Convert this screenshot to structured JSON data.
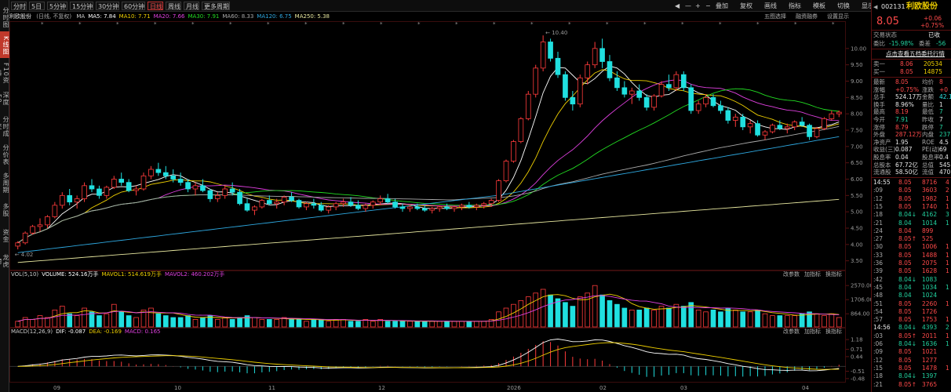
{
  "leftnav": [
    {
      "label": "分时图",
      "active": false
    },
    {
      "label": "K线图",
      "active": true
    },
    {
      "label": "F10资料",
      "active": false
    },
    {
      "label": "深度F9",
      "active": false
    },
    {
      "label": "分时成交",
      "active": false
    },
    {
      "label": "分价表",
      "active": false
    },
    {
      "label": "多周期",
      "active": false
    },
    {
      "label": "多股",
      "active": false
    },
    {
      "label": "资金",
      "active": false
    },
    {
      "label": "龙虎榜",
      "active": false
    }
  ],
  "toolbar": {
    "periods": [
      {
        "label": "分时",
        "active": false
      },
      {
        "label": "5日",
        "active": false
      },
      {
        "label": "5分钟",
        "active": false
      },
      {
        "label": "15分钟",
        "active": false
      },
      {
        "label": "30分钟",
        "active": false
      },
      {
        "label": "60分钟",
        "active": false
      },
      {
        "label": "日线",
        "active": true
      },
      {
        "label": "周线",
        "active": false
      },
      {
        "label": "月线",
        "active": false
      },
      {
        "label": "更多周期",
        "active": false
      }
    ],
    "right_items": [
      "◀",
      "—",
      "+",
      "−",
      "叠加",
      "复权",
      "画线",
      "指标",
      "模板",
      "切换",
      "显示",
      "□",
      "✕"
    ],
    "sub_items": [
      "五图选择",
      "融资融券",
      "设置显示"
    ]
  },
  "ma_legend": {
    "stock_name": "利欧股份",
    "qualifier": "(日线, 不复权)",
    "items": [
      {
        "label": "MA",
        "color": "#cccccc"
      },
      {
        "label": "MA5: 7.84",
        "color": "#ffffff"
      },
      {
        "label": "MA10: 7.71",
        "color": "#f0d000"
      },
      {
        "label": "MA20: 7.66",
        "color": "#e040e0"
      },
      {
        "label": "MA30: 7.91",
        "color": "#22dd22"
      },
      {
        "label": "MA60: 8.33",
        "color": "#aaaaaa"
      },
      {
        "label": "MA120: 6.75",
        "color": "#2ea8e0"
      },
      {
        "label": "MA250: 5.38",
        "color": "#e8e8a0"
      }
    ]
  },
  "price_axis": [
    "10.00",
    "9.50",
    "9.00",
    "8.50",
    "8.00",
    "7.50",
    "7.00",
    "6.50",
    "6.00",
    "5.50",
    "5.00",
    "4.50",
    "4.00",
    "3.50"
  ],
  "price_annotations": {
    "high": "10.40",
    "low": "4.02"
  },
  "vol_legend": {
    "items": [
      {
        "label": "VOL(5,10)",
        "color": "#cccccc"
      },
      {
        "label": "VOLUME: 524.16万手",
        "color": "#ffffff"
      },
      {
        "label": "MAVOL1: 514.619万手",
        "color": "#f0d000"
      },
      {
        "label": "MAVOL2: 460.202万手",
        "color": "#e040e0"
      }
    ],
    "axis": [
      "2570.00",
      "1706.00",
      "864.00"
    ],
    "tabs": [
      "改参数",
      "加指标",
      "换指标"
    ]
  },
  "macd_legend": {
    "items": [
      {
        "label": "MACD(12,26,9)",
        "color": "#cccccc"
      },
      {
        "label": "DIF: -0.087",
        "color": "#ffffff"
      },
      {
        "label": "DEA: -0.169",
        "color": "#f0d000"
      },
      {
        "label": "MACD: 0.165",
        "color": "#e040e0"
      }
    ],
    "axis": [
      "1.18",
      "0.71",
      "0.44",
      "-0.51",
      "-0.48"
    ],
    "tabs": [
      "改参数",
      "加指标",
      "换指标"
    ]
  },
  "time_axis": [
    "09",
    "10",
    "11",
    "12",
    "2026",
    "02",
    "03",
    "04"
  ],
  "quote": {
    "code": "002131",
    "name": "利欧股份",
    "price": "8.05",
    "change": "+0.06",
    "change_pct": "+0.75%",
    "status_label": "交易状态",
    "status_value": "已收",
    "ratio_label": "委比",
    "ratio_value": "-15.98%",
    "diff_label": "委差",
    "diff_value": "-56",
    "link_text": "点击查看五档委托行情",
    "order_book": [
      {
        "label": "卖一",
        "price": "8.06",
        "vol": "20534"
      },
      {
        "label": "买一",
        "price": "8.05",
        "vol": "14875"
      }
    ],
    "stats": [
      {
        "l1": "最新",
        "v1": "8.05",
        "c1": "red",
        "l2": "均价",
        "v2": "8",
        "c2": "red"
      },
      {
        "l1": "涨幅",
        "v1": "+0.75%",
        "c1": "red",
        "l2": "涨跌",
        "v2": "+0",
        "c2": "red"
      },
      {
        "l1": "总手",
        "v1": "524.17万",
        "c1": "white",
        "l2": "金额",
        "v2": "42.1",
        "c2": "cyan"
      },
      {
        "l1": "换手",
        "v1": "8.96%",
        "c1": "white",
        "l2": "量比",
        "v2": "1",
        "c2": "white"
      },
      {
        "l1": "最高",
        "v1": "8.19",
        "c1": "red",
        "l2": "最低",
        "v2": "7",
        "c2": "green"
      },
      {
        "l1": "今开",
        "v1": "7.91",
        "c1": "green",
        "l2": "昨收",
        "v2": "7",
        "c2": "white"
      },
      {
        "l1": "涨停",
        "v1": "8.79",
        "c1": "red",
        "l2": "跌停",
        "v2": "7",
        "c2": "green"
      },
      {
        "l1": "外盘",
        "v1": "287.12万",
        "c1": "red",
        "l2": "内盘",
        "v2": "237.0",
        "c2": "green"
      },
      {
        "l1": "净资产",
        "v1": "1.95",
        "c1": "white",
        "l2": "ROE",
        "v2": "4.5",
        "c2": "white"
      },
      {
        "l1": "收益(三)",
        "v1": "0.087",
        "c1": "white",
        "l2": "PE(动)",
        "v2": "69",
        "c2": "white"
      },
      {
        "l1": "股息率",
        "v1": "0.04",
        "c1": "white",
        "l2": "股息率",
        "v2": "0.4",
        "c2": "white"
      },
      {
        "l1": "总股本",
        "v1": "67.72亿",
        "c1": "white",
        "l2": "总值",
        "v2": "545.1",
        "c2": "white"
      },
      {
        "l1": "流通股",
        "v1": "58.50亿",
        "c1": "white",
        "l2": "流值",
        "v2": "470.9",
        "c2": "white"
      }
    ],
    "ticks": [
      {
        "t": "14:55",
        "p": "8.05",
        "v": "8716",
        "d": "4",
        "c": "red"
      },
      {
        "t": ":09",
        "p": "8.05",
        "v": "3603",
        "d": "2",
        "c": "red"
      },
      {
        "t": ":12",
        "p": "8.05",
        "v": "1982",
        "d": "1",
        "c": "red"
      },
      {
        "t": ":15",
        "p": "8.05",
        "v": "1740",
        "d": "1",
        "c": "red"
      },
      {
        "t": ":18",
        "p": "8.04↓",
        "v": "4162",
        "d": "3",
        "c": "green"
      },
      {
        "t": ":21",
        "p": "8.04",
        "v": "1014",
        "d": "1",
        "c": "green"
      },
      {
        "t": ":24",
        "p": "8.04",
        "v": "899",
        "d": "",
        "c": "red"
      },
      {
        "t": ":27",
        "p": "8.05↑",
        "v": "525",
        "d": "",
        "c": "red"
      },
      {
        "t": ":30",
        "p": "8.05",
        "v": "1006",
        "d": "1",
        "c": "red"
      },
      {
        "t": ":33",
        "p": "8.05",
        "v": "1488",
        "d": "1",
        "c": "red"
      },
      {
        "t": ":36",
        "p": "8.05",
        "v": "2075",
        "d": "1",
        "c": "red"
      },
      {
        "t": ":39",
        "p": "8.05",
        "v": "1628",
        "d": "1",
        "c": "red"
      },
      {
        "t": ":42",
        "p": "8.04↓",
        "v": "1083",
        "d": "",
        "c": "green"
      },
      {
        "t": ":45",
        "p": "8.04",
        "v": "1034",
        "d": "1",
        "c": "green"
      },
      {
        "t": ":48",
        "p": "8.04",
        "v": "1024",
        "d": "",
        "c": "green"
      },
      {
        "t": ":51",
        "p": "8.05",
        "v": "2260",
        "d": "1",
        "c": "red"
      },
      {
        "t": ":54",
        "p": "8.05",
        "v": "1726",
        "d": "",
        "c": "red"
      },
      {
        "t": ":57",
        "p": "8.05",
        "v": "1753",
        "d": "1",
        "c": "red"
      },
      {
        "t": "14:56",
        "p": "8.04↓",
        "v": "4393",
        "d": "2",
        "c": "green"
      },
      {
        "t": ":03",
        "p": "8.05↑",
        "v": "2011",
        "d": "1",
        "c": "red"
      },
      {
        "t": ":06",
        "p": "8.04↓",
        "v": "1636",
        "d": "1",
        "c": "green"
      },
      {
        "t": ":09",
        "p": "8.05",
        "v": "1021",
        "d": "",
        "c": "red"
      },
      {
        "t": ":12",
        "p": "8.05",
        "v": "1277",
        "d": "",
        "c": "red"
      },
      {
        "t": ":15",
        "p": "8.05",
        "v": "1478",
        "d": "1",
        "c": "red"
      },
      {
        "t": ":18",
        "p": "8.04↓",
        "v": "1397",
        "d": "",
        "c": "green"
      },
      {
        "t": ":21",
        "p": "8.05↑",
        "v": "3765",
        "d": "",
        "c": "red"
      }
    ]
  },
  "chart_data": {
    "type": "candlestick",
    "ylim": [
      3.3,
      10.5
    ],
    "candles": [
      [
        3.95,
        4.1,
        3.85,
        4.05
      ],
      [
        4.05,
        4.4,
        4.0,
        4.35
      ],
      [
        4.35,
        4.6,
        4.3,
        4.55
      ],
      [
        4.55,
        4.8,
        4.4,
        4.6
      ],
      [
        4.6,
        4.9,
        4.5,
        4.85
      ],
      [
        4.85,
        5.3,
        4.8,
        5.2
      ],
      [
        5.2,
        5.6,
        5.1,
        5.5
      ],
      [
        5.5,
        5.7,
        5.2,
        5.3
      ],
      [
        5.3,
        5.5,
        5.1,
        5.4
      ],
      [
        5.4,
        5.9,
        5.3,
        5.8
      ],
      [
        5.8,
        6.0,
        5.6,
        5.7
      ],
      [
        5.7,
        5.8,
        5.4,
        5.5
      ],
      [
        5.5,
        5.8,
        5.4,
        5.75
      ],
      [
        5.75,
        6.1,
        5.7,
        6.0
      ],
      [
        6.0,
        6.2,
        5.8,
        5.9
      ],
      [
        5.9,
        6.0,
        5.6,
        5.65
      ],
      [
        5.65,
        5.8,
        5.5,
        5.7
      ],
      [
        5.7,
        6.2,
        5.65,
        6.1
      ],
      [
        6.1,
        6.4,
        6.0,
        6.3
      ],
      [
        6.3,
        6.5,
        6.1,
        6.2
      ],
      [
        6.2,
        6.4,
        6.0,
        6.1
      ],
      [
        6.1,
        6.3,
        5.9,
        6.0
      ],
      [
        6.0,
        6.2,
        5.8,
        5.9
      ],
      [
        5.9,
        6.0,
        5.6,
        5.7
      ],
      [
        5.7,
        5.9,
        5.5,
        5.8
      ],
      [
        5.8,
        6.0,
        5.6,
        5.65
      ],
      [
        5.65,
        5.7,
        5.3,
        5.4
      ],
      [
        5.4,
        5.6,
        5.3,
        5.5
      ],
      [
        5.5,
        5.8,
        5.4,
        5.7
      ],
      [
        5.7,
        5.9,
        5.5,
        5.6
      ],
      [
        5.6,
        5.7,
        5.2,
        5.25
      ],
      [
        5.25,
        5.4,
        5.0,
        5.05
      ],
      [
        5.05,
        5.2,
        4.9,
        5.15
      ],
      [
        5.15,
        5.4,
        5.1,
        5.35
      ],
      [
        5.35,
        5.5,
        5.2,
        5.25
      ],
      [
        5.25,
        5.4,
        5.1,
        5.3
      ],
      [
        5.3,
        5.5,
        5.2,
        5.45
      ],
      [
        5.45,
        5.6,
        5.3,
        5.35
      ],
      [
        5.35,
        5.4,
        5.1,
        5.15
      ],
      [
        5.15,
        5.3,
        5.05,
        5.25
      ],
      [
        5.25,
        5.4,
        5.1,
        5.2
      ],
      [
        5.2,
        5.3,
        5.0,
        5.05
      ],
      [
        5.05,
        5.2,
        4.95,
        5.15
      ],
      [
        5.15,
        5.3,
        5.05,
        5.25
      ],
      [
        5.25,
        5.4,
        5.15,
        5.3
      ],
      [
        5.3,
        5.45,
        5.15,
        5.2
      ],
      [
        5.2,
        5.35,
        5.05,
        5.1
      ],
      [
        5.1,
        5.25,
        5.0,
        5.2
      ],
      [
        5.2,
        5.35,
        5.1,
        5.3
      ],
      [
        5.3,
        5.5,
        5.2,
        5.4
      ],
      [
        5.4,
        5.55,
        5.25,
        5.3
      ],
      [
        5.3,
        5.4,
        5.1,
        5.15
      ],
      [
        5.15,
        5.25,
        5.0,
        5.1
      ],
      [
        5.1,
        5.2,
        5.0,
        5.15
      ],
      [
        5.15,
        5.25,
        5.05,
        5.1
      ],
      [
        5.1,
        5.2,
        5.0,
        5.05
      ],
      [
        5.05,
        5.15,
        4.95,
        5.1
      ],
      [
        5.1,
        5.2,
        5.0,
        5.15
      ],
      [
        5.15,
        5.25,
        5.05,
        5.1
      ],
      [
        5.1,
        5.2,
        5.0,
        5.15
      ],
      [
        5.15,
        5.25,
        5.05,
        5.2
      ],
      [
        5.2,
        5.3,
        5.1,
        5.15
      ],
      [
        5.15,
        5.25,
        5.05,
        5.2
      ],
      [
        5.2,
        5.3,
        5.1,
        5.25
      ],
      [
        5.25,
        5.4,
        5.15,
        5.35
      ],
      [
        5.35,
        6.0,
        5.3,
        5.95
      ],
      [
        5.95,
        6.6,
        5.9,
        6.55
      ],
      [
        6.55,
        7.2,
        6.5,
        7.15
      ],
      [
        7.15,
        7.9,
        7.1,
        7.85
      ],
      [
        7.85,
        8.7,
        7.8,
        8.6
      ],
      [
        8.6,
        9.5,
        8.5,
        9.4
      ],
      [
        9.4,
        10.4,
        9.3,
        10.2
      ],
      [
        10.2,
        10.3,
        9.6,
        9.7
      ],
      [
        9.7,
        9.9,
        9.1,
        9.2
      ],
      [
        9.2,
        9.3,
        8.4,
        8.5
      ],
      [
        8.5,
        8.7,
        8.1,
        8.3
      ],
      [
        8.3,
        9.2,
        8.2,
        9.1
      ],
      [
        9.1,
        9.6,
        8.9,
        9.5
      ],
      [
        9.5,
        10.2,
        9.4,
        10.0
      ],
      [
        10.0,
        10.3,
        9.4,
        9.6
      ],
      [
        9.6,
        9.8,
        9.0,
        9.1
      ],
      [
        9.1,
        9.3,
        8.7,
        8.8
      ],
      [
        8.8,
        9.0,
        8.5,
        8.6
      ],
      [
        8.6,
        8.8,
        8.3,
        8.7
      ],
      [
        8.7,
        8.9,
        8.4,
        8.5
      ],
      [
        8.5,
        8.6,
        8.1,
        8.2
      ],
      [
        8.2,
        8.6,
        8.1,
        8.55
      ],
      [
        8.55,
        9.0,
        8.5,
        8.9
      ],
      [
        8.9,
        9.2,
        8.7,
        8.8
      ],
      [
        8.8,
        9.3,
        8.7,
        9.2
      ],
      [
        9.2,
        9.3,
        8.7,
        8.8
      ],
      [
        8.8,
        8.9,
        8.0,
        8.1
      ],
      [
        8.1,
        8.4,
        8.0,
        8.3
      ],
      [
        8.3,
        8.6,
        8.2,
        8.5
      ],
      [
        8.5,
        8.6,
        8.2,
        8.25
      ],
      [
        8.25,
        8.4,
        8.0,
        8.1
      ],
      [
        8.1,
        8.2,
        7.7,
        7.8
      ],
      [
        7.8,
        8.0,
        7.6,
        7.9
      ],
      [
        7.9,
        8.0,
        7.5,
        7.6
      ],
      [
        7.6,
        7.8,
        7.4,
        7.7
      ],
      [
        7.7,
        7.8,
        7.3,
        7.35
      ],
      [
        7.35,
        7.5,
        7.2,
        7.45
      ],
      [
        7.45,
        7.7,
        7.4,
        7.65
      ],
      [
        7.65,
        7.8,
        7.5,
        7.55
      ],
      [
        7.55,
        7.7,
        7.4,
        7.6
      ],
      [
        7.6,
        7.8,
        7.5,
        7.75
      ],
      [
        7.75,
        7.9,
        7.6,
        7.65
      ],
      [
        7.65,
        7.7,
        7.2,
        7.3
      ],
      [
        7.3,
        7.6,
        7.25,
        7.55
      ],
      [
        7.55,
        7.9,
        7.5,
        7.85
      ],
      [
        7.85,
        8.1,
        7.8,
        8.0
      ],
      [
        8.0,
        8.1,
        7.9,
        8.05
      ]
    ],
    "ma_series": [
      {
        "name": "MA5",
        "color": "#ffffff"
      },
      {
        "name": "MA10",
        "color": "#f0d000"
      },
      {
        "name": "MA20",
        "color": "#e040e0"
      },
      {
        "name": "MA30",
        "color": "#22dd22"
      },
      {
        "name": "MA60",
        "color": "#aaaaaa"
      },
      {
        "name": "MA120",
        "color": "#2ea8e0"
      },
      {
        "name": "MA250",
        "color": "#e8e8a0"
      }
    ],
    "volume": [
      3,
      5,
      4,
      6,
      5,
      9,
      11,
      7,
      6,
      10,
      8,
      6,
      7,
      12,
      8,
      6,
      5,
      9,
      10,
      7,
      6,
      5,
      5,
      6,
      4,
      5,
      6,
      4,
      5,
      4,
      5,
      6,
      5,
      4,
      4,
      4,
      5,
      4,
      4,
      3,
      4,
      4,
      3,
      4,
      4,
      3,
      3,
      4,
      3,
      4,
      3,
      3,
      3,
      3,
      3,
      3,
      3,
      3,
      3,
      3,
      3,
      3,
      3,
      3,
      4,
      8,
      10,
      12,
      14,
      16,
      18,
      20,
      17,
      15,
      13,
      11,
      16,
      18,
      22,
      17,
      14,
      12,
      10,
      9,
      9,
      10,
      9,
      11,
      10,
      12,
      11,
      13,
      9,
      8,
      9,
      8,
      10,
      9,
      8,
      8,
      9,
      7,
      6,
      6,
      6,
      6,
      7,
      8,
      7,
      6,
      7,
      5
    ],
    "volume_ylim": [
      0,
      25
    ],
    "macd_ylim": [
      -0.6,
      1.2
    ]
  }
}
